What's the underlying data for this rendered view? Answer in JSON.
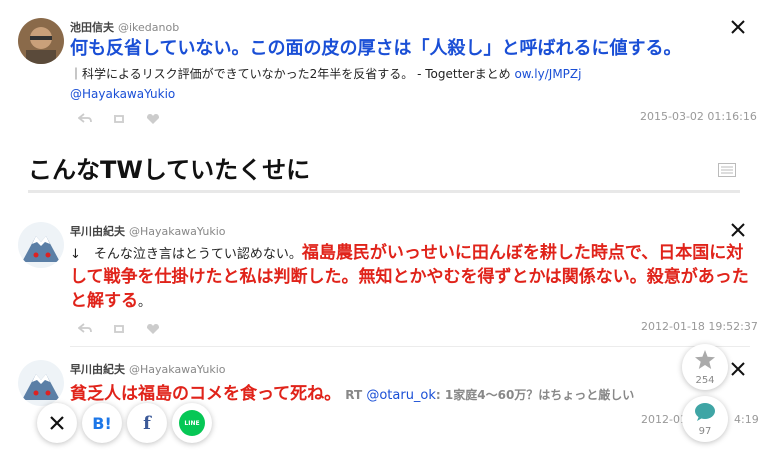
{
  "colors": {
    "blue": "#1a4fd6",
    "red": "#e0231a",
    "line_green": "#06c755",
    "hatebu_blue": "#1d77e8",
    "facebook_blue": "#3b5998",
    "comment_teal": "#3fa5a5"
  },
  "tweet1": {
    "name": "池田信夫",
    "handle": "@ikedanob",
    "headline": "何も反省していない。この面の皮の厚さは「人殺し」と呼ばれるに値する。",
    "subtext": "｜科学によるリスク評価ができていなかった2年半を反省する。 - Togetterまとめ",
    "link": "ow.ly/JMPZj",
    "mention": "@HayakawaYukio",
    "timestamp": "2015-03-02 01:16:16"
  },
  "section_heading": "こんなTWしていたくせに",
  "tweet2": {
    "name": "早川由紀夫",
    "handle": "@HayakawaYukio",
    "prefix": "↓　そんな泣き言はとうてい認めない。",
    "red_part": "福島農民がいっせいに田んぼを耕した時点で、日本国に対して戦争を仕掛けたと私は判断した。無知とかやむを得ずとかは関係ない。殺意があったと解する",
    "suffix": "。",
    "timestamp": "2012-01-18 19:52:37"
  },
  "tweet3": {
    "name": "早川由紀夫",
    "handle": "@HayakawaYukio",
    "red_part": "貧乏人は福島のコメを食って死ね。",
    "rt_label": "RT",
    "rt_handle": "@otaru_ok",
    "rt_text": ": 1家庭4〜60万？はちょっと厳しい",
    "timestamp_left": "2012-01",
    "timestamp_right": "4:19"
  },
  "share": {
    "hatebu_label": "B!",
    "facebook_label": "f",
    "line_label": "LINE"
  },
  "side": {
    "favorites_count": "254",
    "comments_count": "97"
  }
}
